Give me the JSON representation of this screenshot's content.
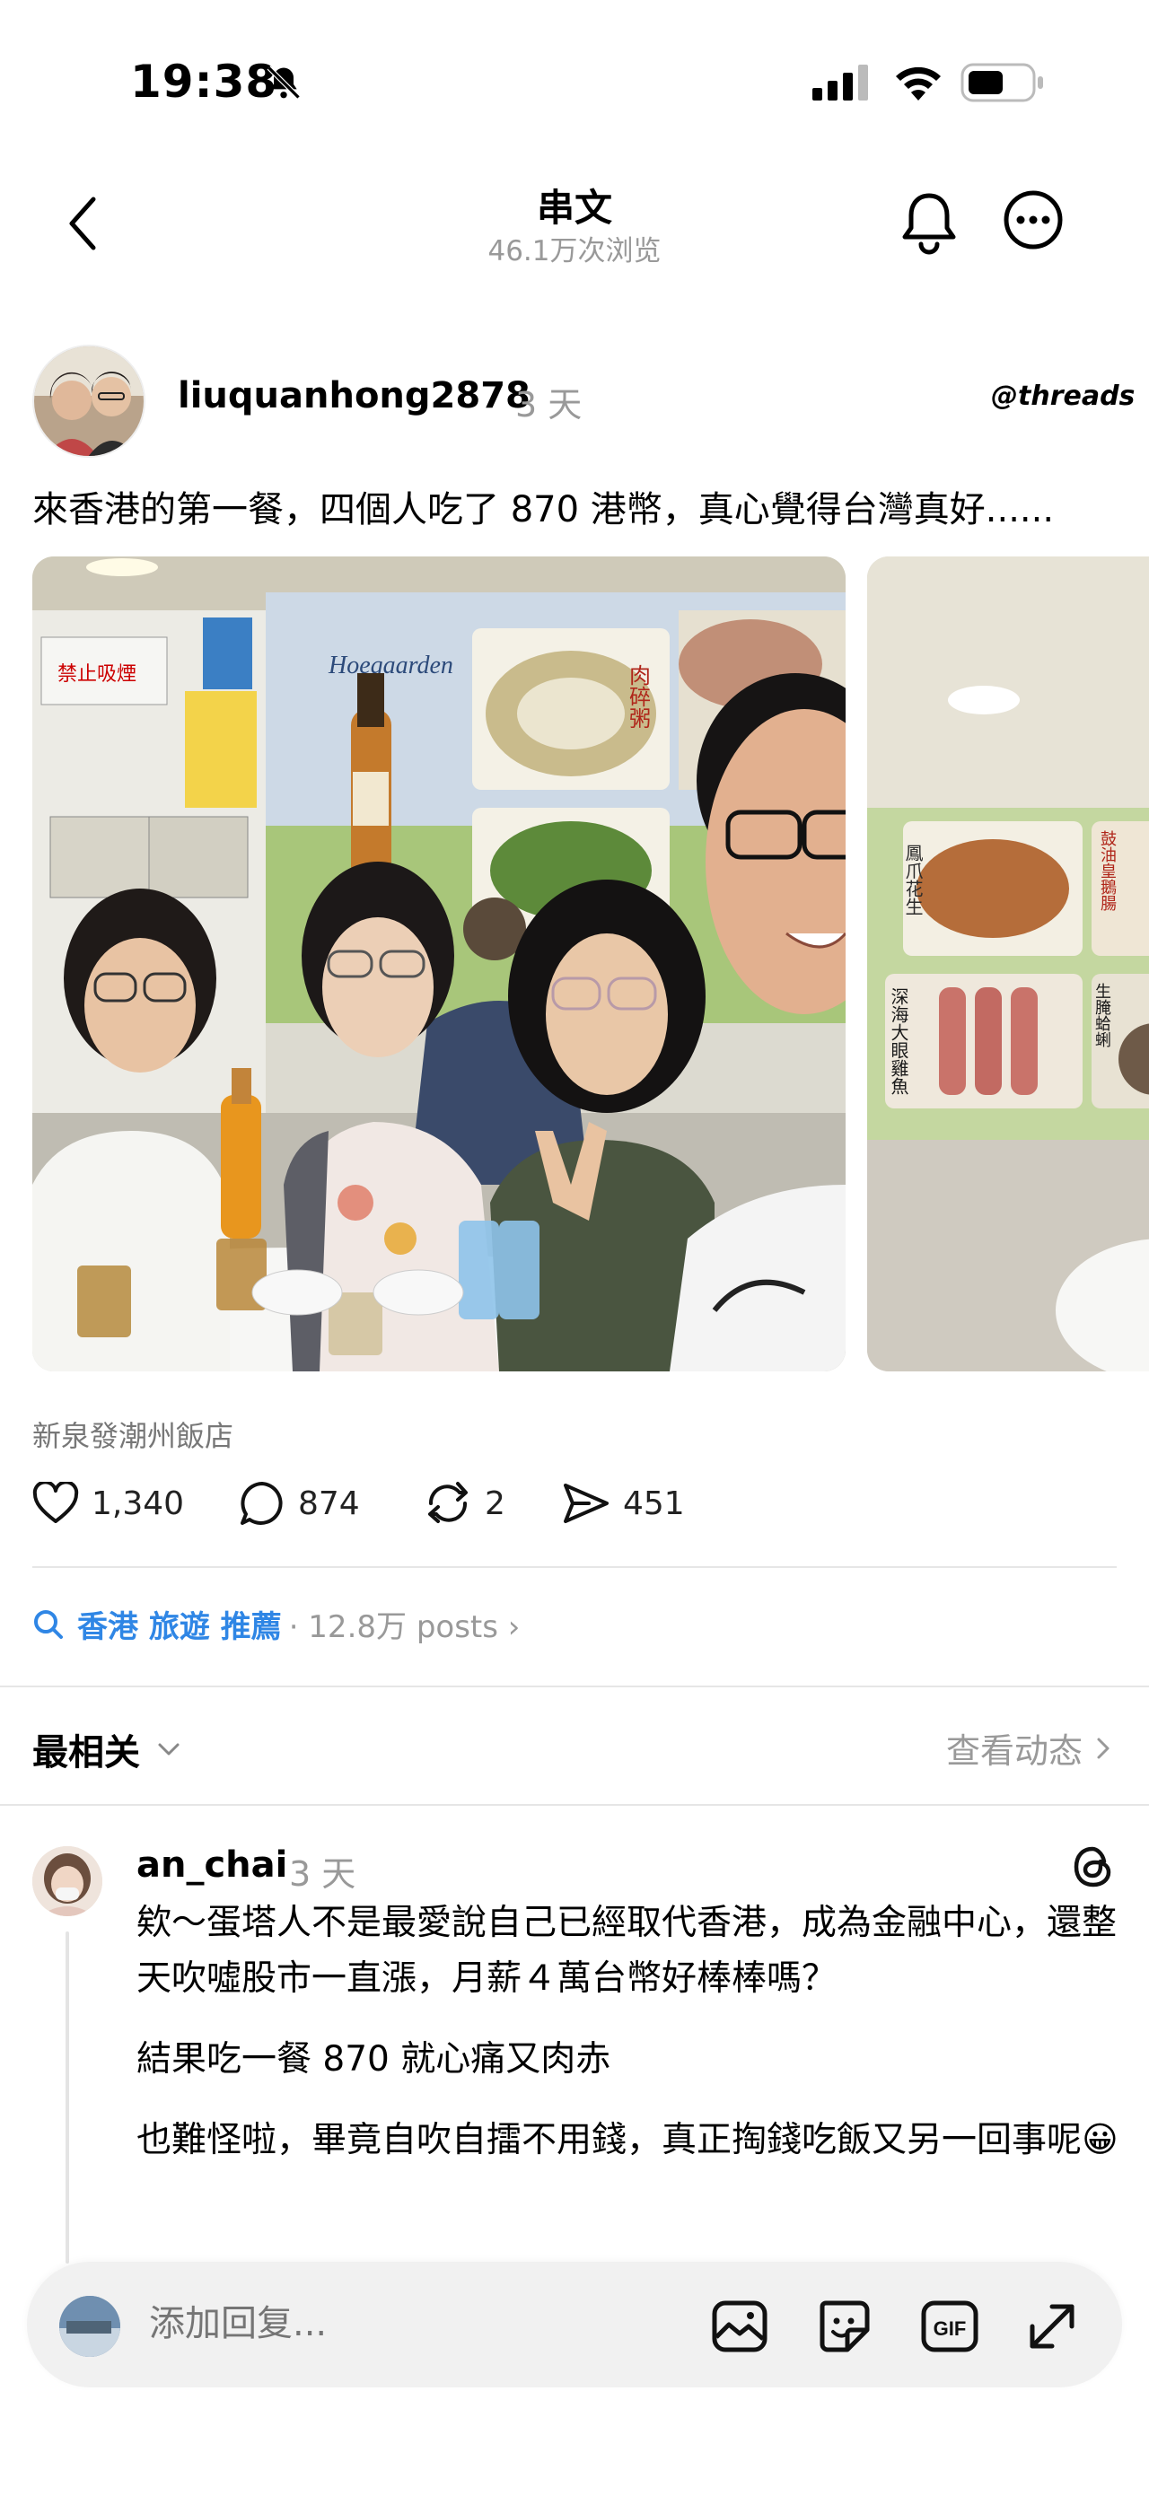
{
  "status_bar": {
    "time": "19:38"
  },
  "header": {
    "title": "串文",
    "views": "46.1万次浏览"
  },
  "post": {
    "username": "liuquanhong2878",
    "time": "3 天",
    "brand": "threads",
    "text": "來香港的第一餐，四個人吃了 870 港幣，真心覺得台灣真好......",
    "photo_text": {
      "sign1": "禁止吸煙",
      "sign2": "肉碎粥",
      "brand": "Hoegaarden",
      "dish1": "鳳爪花生",
      "dish2": "鼓油皇鵝腸",
      "dish3": "深海大眼雞魚",
      "dish4": "生腌蛤蜊"
    },
    "location": "新泉發潮州飯店",
    "stats": {
      "likes": "1,340",
      "comments": "874",
      "reposts": "2",
      "shares": "451"
    }
  },
  "topic": {
    "tag": "香港 旅遊 推薦",
    "count": "· 12.8万 posts ›"
  },
  "sort": {
    "label": "最相关",
    "view_activity": "查看动态"
  },
  "comment": {
    "username": "an_chai",
    "time": "3 天",
    "paragraphs": [
      "欸～蛋塔人不是最愛說自己已經取代香港，成為金融中心，還整天吹噓股市一直漲，月薪４萬台幣好棒棒嗎？",
      "結果吃一餐 870 就心痛又肉赤",
      "也難怪啦，畢竟自吹自擂不用錢，真正掏錢吃飯又另一回事呢😀"
    ]
  },
  "reply_bar": {
    "placeholder": "添加回复..."
  },
  "colors": {
    "link": "#2f86e5",
    "muted": "#999999",
    "divider": "#e6e6e6"
  }
}
